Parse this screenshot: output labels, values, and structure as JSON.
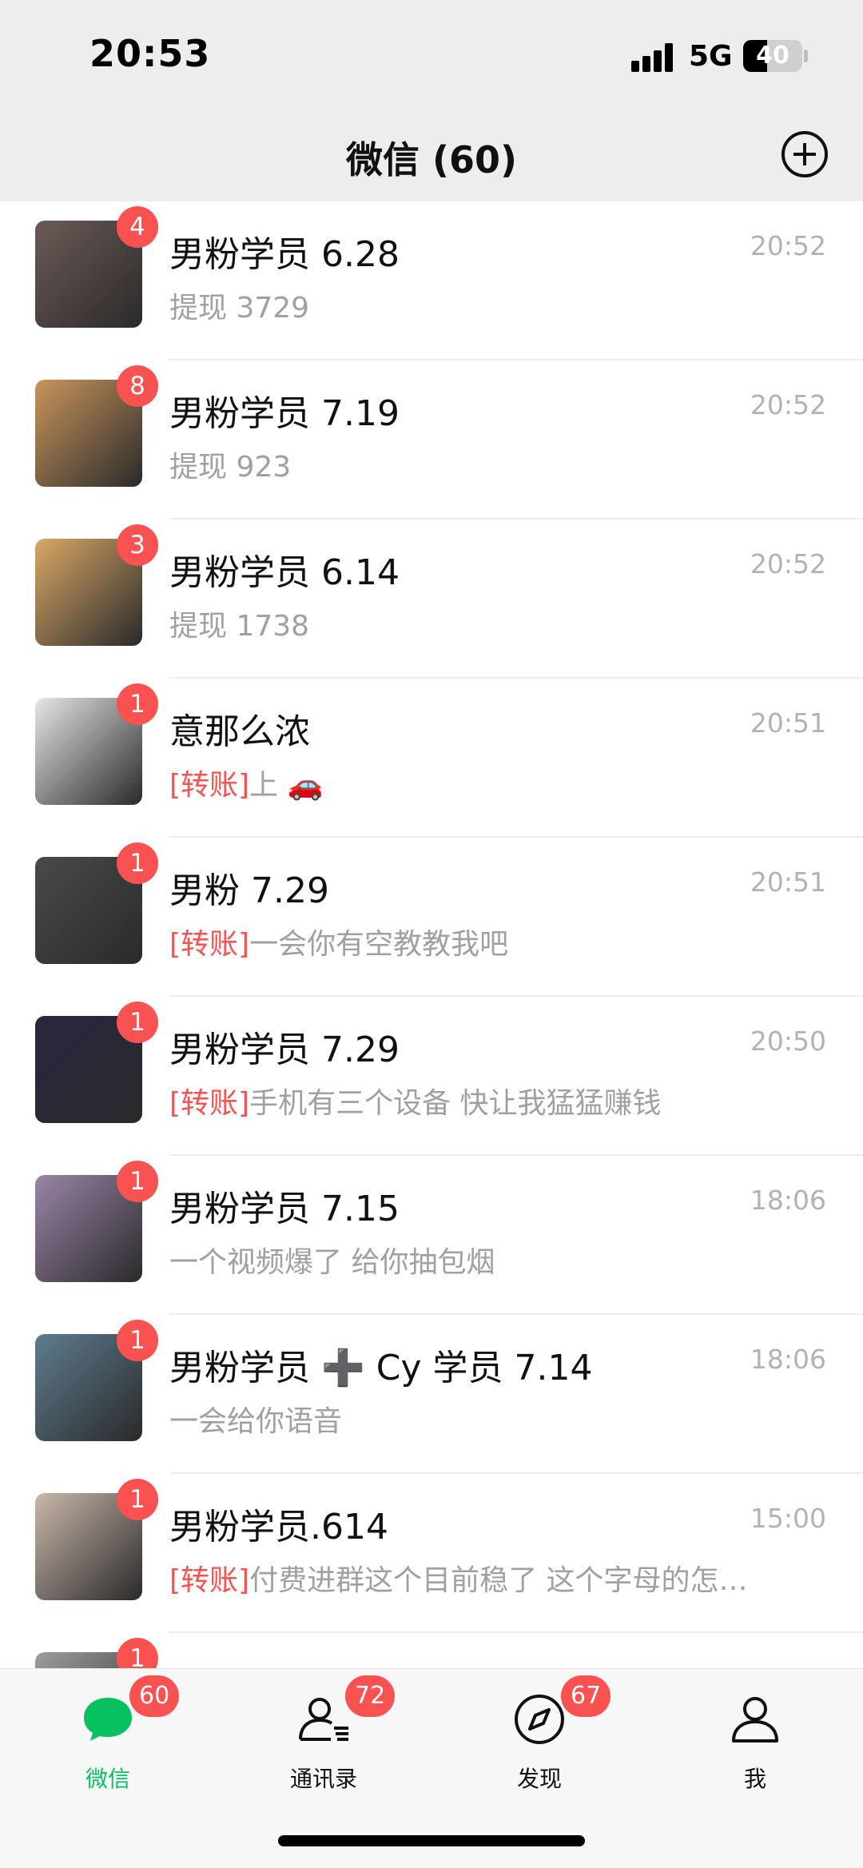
{
  "status_bar": {
    "time": "20:53",
    "network": "5G",
    "battery": "40",
    "battery_level": 0.4
  },
  "header": {
    "title": "微信 (60)"
  },
  "chats": [
    {
      "name": "男粉学员 6.28",
      "time": "20:52",
      "tag": "",
      "preview": "提现 3729",
      "badge": "4",
      "avatar_color": "#6b5a55"
    },
    {
      "name": "男粉学员 7.19",
      "time": "20:52",
      "tag": "",
      "preview": "提现 923",
      "badge": "8",
      "avatar_color": "#c9955c"
    },
    {
      "name": "男粉学员 6.14",
      "time": "20:52",
      "tag": "",
      "preview": "提现 1738",
      "badge": "3",
      "avatar_color": "#d9a766"
    },
    {
      "name": "意那么浓",
      "time": "20:51",
      "tag": "[转账]",
      "preview": "上 🚗",
      "badge": "1",
      "avatar_color": "#e6e6e6"
    },
    {
      "name": "男粉 7.29",
      "time": "20:51",
      "tag": "[转账]",
      "preview": "一会你有空教教我吧",
      "badge": "1",
      "avatar_color": "#4a4a4a"
    },
    {
      "name": "男粉学员 7.29",
      "time": "20:50",
      "tag": "[转账]",
      "preview": "手机有三个设备 快让我猛猛赚钱",
      "badge": "1",
      "avatar_color": "#2b2540"
    },
    {
      "name": "男粉学员 7.15",
      "time": "18:06",
      "tag": "",
      "preview": "一个视频爆了 给你抽包烟",
      "badge": "1",
      "avatar_color": "#9a86a8"
    },
    {
      "name": "男粉学员 ➕ Cy 学员 7.14",
      "time": "18:06",
      "tag": "",
      "preview": "一会给你语音",
      "badge": "1",
      "avatar_color": "#5e7c8e"
    },
    {
      "name": "男粉学员.614",
      "time": "15:00",
      "tag": "[转账]",
      "preview": "付费进群这个目前稳了 这个字母的怎…",
      "badge": "1",
      "avatar_color": "#c9b7aa"
    },
    {
      "name": "",
      "time": "",
      "tag": "",
      "preview": "",
      "badge": "1",
      "avatar_color": "#9e9e9e"
    }
  ],
  "tabs": [
    {
      "label": "微信",
      "badge": "60",
      "icon": "chat-bubble-icon",
      "active": true
    },
    {
      "label": "通讯录",
      "badge": "72",
      "icon": "contacts-icon",
      "active": false
    },
    {
      "label": "发现",
      "badge": "67",
      "icon": "compass-icon",
      "active": false
    },
    {
      "label": "我",
      "badge": "",
      "icon": "person-icon",
      "active": false
    }
  ],
  "colors": {
    "accent": "#07c160",
    "badge": "#fa5151",
    "header_bg": "#ededed"
  }
}
